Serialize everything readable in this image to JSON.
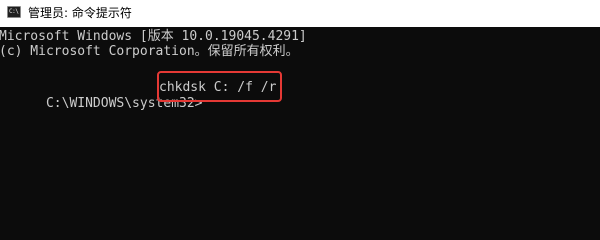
{
  "window": {
    "title": "管理员: 命令提示符",
    "icon": "cmd-icon",
    "icon_glyph": "C:\\"
  },
  "console": {
    "lines": [
      "Microsoft Windows [版本 10.0.19045.4291]",
      "(c) Microsoft Corporation。保留所有权利。"
    ],
    "prompt": "C:\\WINDOWS\\system32>",
    "command": "chkdsk C: /f /r"
  },
  "colors": {
    "background": "#0c0c0c",
    "text": "#cccccc",
    "titlebar": "#ffffff",
    "highlight_box": "#e53935"
  }
}
